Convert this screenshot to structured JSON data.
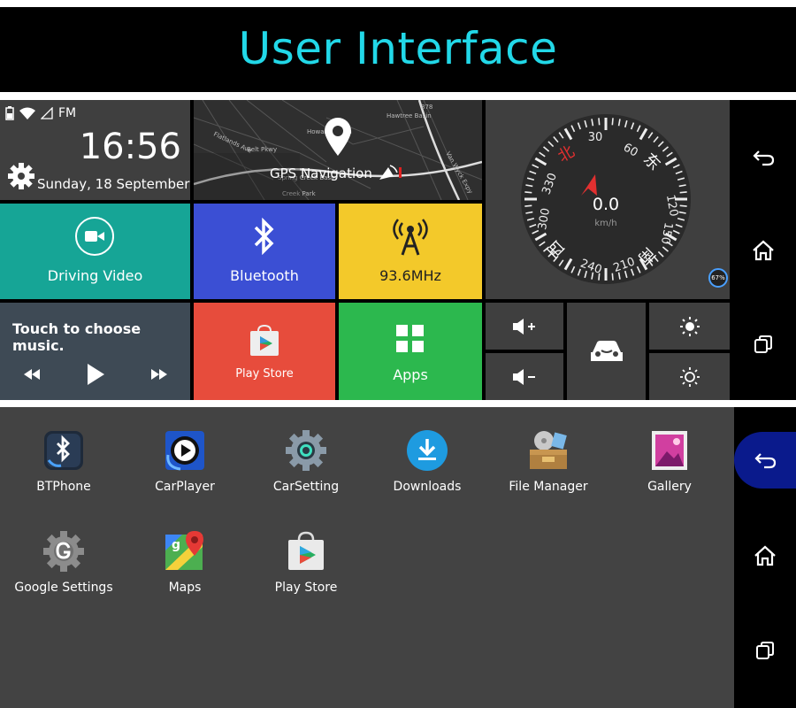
{
  "banner": {
    "title": "User Interface"
  },
  "status_bar": {
    "fm_label": "FM"
  },
  "clock": {
    "time": "16:56",
    "date": "Sunday, 18 September"
  },
  "gps_tile": {
    "label": "GPS Navigation",
    "map_labels": [
      "Flatlands Ave",
      "Belt Pkwy",
      "Howard Beach",
      "Spring Creek Basin",
      "Hawtree Basin",
      "Van Wyck Expy",
      "Creek Park",
      "878"
    ]
  },
  "speedometer": {
    "speed": "0.0",
    "unit": "km/h",
    "ticks": [
      "30",
      "60",
      "120",
      "150",
      "210",
      "240",
      "300",
      "330"
    ],
    "directions": [
      "北",
      "东",
      "南",
      "西"
    ],
    "battery": "67%"
  },
  "driving_video": {
    "label": "Driving Video"
  },
  "bluetooth_tile": {
    "label": "Bluetooth"
  },
  "fm_tile": {
    "label": "93.6MHz"
  },
  "music_tile": {
    "label": "Touch to choose music."
  },
  "playstore_tile": {
    "label": "Play Store"
  },
  "apps_tile": {
    "label": "Apps"
  },
  "app_drawer": {
    "apps": [
      {
        "label": "BTPhone",
        "icon": "bluetooth-phone-icon"
      },
      {
        "label": "CarPlayer",
        "icon": "car-player-icon"
      },
      {
        "label": "CarSetting",
        "icon": "car-setting-icon"
      },
      {
        "label": "Downloads",
        "icon": "download-icon"
      },
      {
        "label": "File Manager",
        "icon": "file-manager-icon"
      },
      {
        "label": "Gallery",
        "icon": "gallery-icon"
      },
      {
        "label": "Google Settings",
        "icon": "google-settings-icon"
      },
      {
        "label": "Maps",
        "icon": "maps-icon"
      },
      {
        "label": "Play Store",
        "icon": "play-store-icon"
      }
    ]
  },
  "colors": {
    "accent": "#22d8e8",
    "teal": "#16a596",
    "blue": "#3b4fd4",
    "yellow": "#f3c92a",
    "red": "#e74c3c",
    "green": "#2cb84e",
    "dark_tile": "#3f3f3f",
    "nav_active": "#0a1a8c"
  }
}
